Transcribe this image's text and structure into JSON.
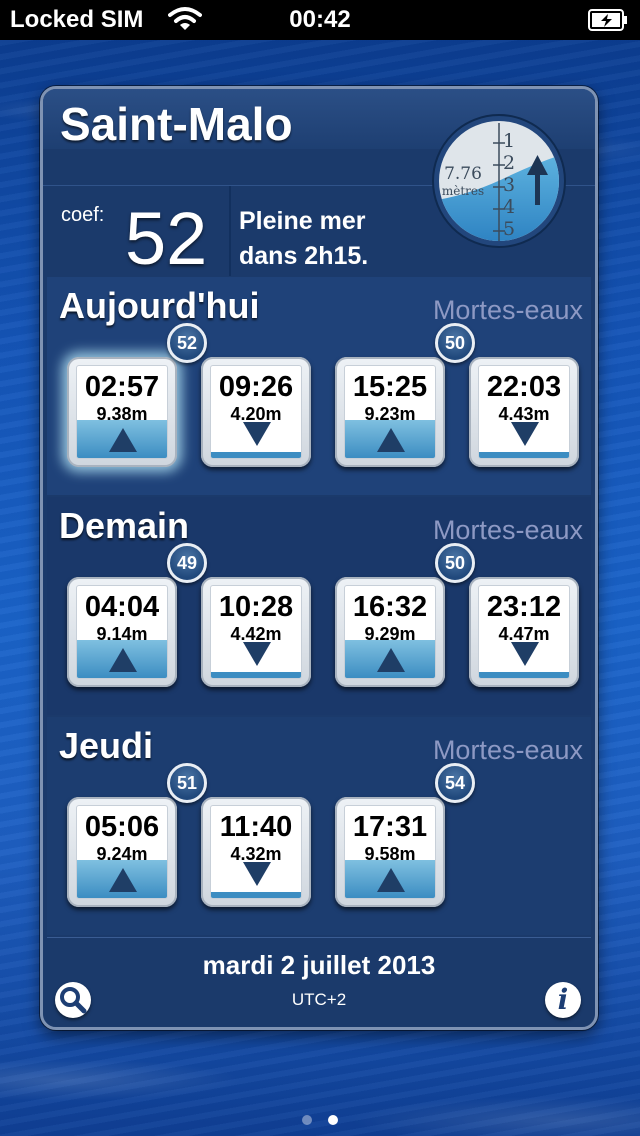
{
  "status_bar": {
    "carrier": "Locked SIM",
    "time": "00:42",
    "icons": [
      "wifi-icon",
      "battery-charging-icon"
    ]
  },
  "header": {
    "city": "Saint-Malo"
  },
  "gauge": {
    "height_value": "7.76",
    "height_unit": "mètres",
    "scale": [
      "1",
      "2",
      "3",
      "4",
      "5"
    ],
    "direction": "rising",
    "icon": "up-arrow-icon"
  },
  "summary": {
    "coef_label": "coef:",
    "coef_value": "52",
    "tide_line1": "Pleine mer",
    "tide_line2": "dans 2h15."
  },
  "days": [
    {
      "title": "Aujourd'hui",
      "phase": "Mortes-eaux",
      "badges": [
        "52",
        "50"
      ],
      "tides": [
        {
          "time": "02:57",
          "height": "9.38m",
          "type": "high",
          "active": true
        },
        {
          "time": "09:26",
          "height": "4.20m",
          "type": "low",
          "active": false
        },
        {
          "time": "15:25",
          "height": "9.23m",
          "type": "high",
          "active": false
        },
        {
          "time": "22:03",
          "height": "4.43m",
          "type": "low",
          "active": false
        }
      ]
    },
    {
      "title": "Demain",
      "phase": "Mortes-eaux",
      "badges": [
        "49",
        "50"
      ],
      "tides": [
        {
          "time": "04:04",
          "height": "9.14m",
          "type": "high",
          "active": false
        },
        {
          "time": "10:28",
          "height": "4.42m",
          "type": "low",
          "active": false
        },
        {
          "time": "16:32",
          "height": "9.29m",
          "type": "high",
          "active": false
        },
        {
          "time": "23:12",
          "height": "4.47m",
          "type": "low",
          "active": false
        }
      ]
    },
    {
      "title": "Jeudi",
      "phase": "Mortes-eaux",
      "badges": [
        "51",
        "54"
      ],
      "tides": [
        {
          "time": "05:06",
          "height": "9.24m",
          "type": "high",
          "active": false
        },
        {
          "time": "11:40",
          "height": "4.32m",
          "type": "low",
          "active": false
        },
        {
          "time": "17:31",
          "height": "9.58m",
          "type": "high",
          "active": false
        }
      ]
    }
  ],
  "footer": {
    "date": "mardi 2 juillet 2013",
    "timezone": "UTC+2",
    "icons": [
      "search-icon",
      "info-icon"
    ]
  },
  "page_control": {
    "pages": 2,
    "current_page": 2
  }
}
